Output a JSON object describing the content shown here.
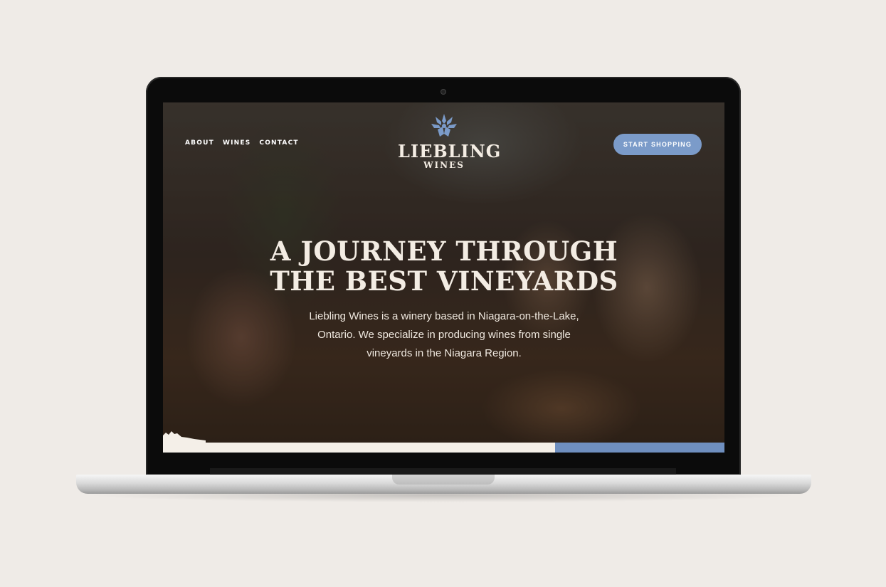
{
  "site": {
    "nav": [
      {
        "label": "ABOUT"
      },
      {
        "label": "WINES"
      },
      {
        "label": "CONTACT"
      }
    ],
    "logo": {
      "name": "LIEBLING",
      "sub": "WINES"
    },
    "cta_label": "START SHOPPING",
    "hero": {
      "headline_line1": "A JOURNEY THROUGH",
      "headline_line2": "THE BEST VINEYARDS",
      "description": "Liebling Wines is a winery based in Niagara-on-the-Lake, Ontario. We specialize in producing wines from single vineyards in the Niagara Region."
    }
  },
  "colors": {
    "accent": "#7b9bc9",
    "text_light": "#f3ece3",
    "background": "#efebe7"
  },
  "icons": {
    "logo": "cornflower-icon"
  }
}
